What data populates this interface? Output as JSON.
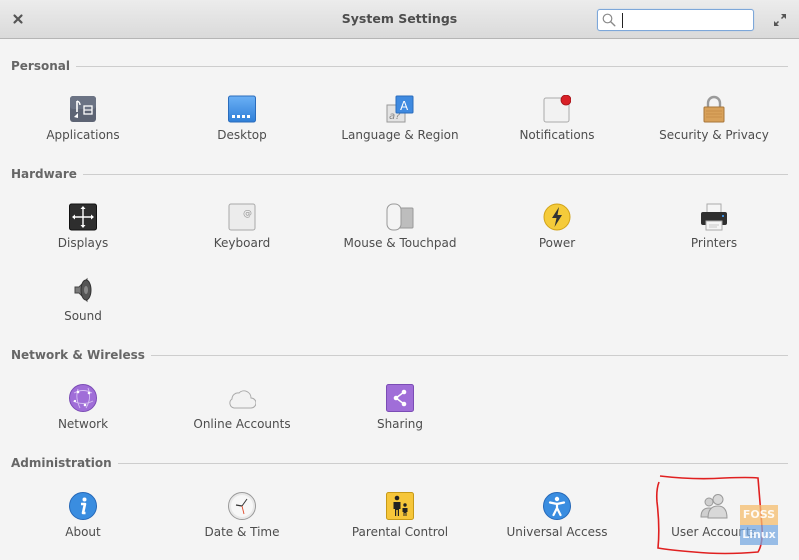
{
  "window": {
    "title": "System Settings",
    "search": {
      "value": "",
      "placeholder": ""
    },
    "close_icon": "close-icon",
    "maximize_icon": "maximize-icon"
  },
  "sections": [
    {
      "title": "Personal",
      "items": [
        {
          "label": "Applications",
          "icon": "applications-icon"
        },
        {
          "label": "Desktop",
          "icon": "desktop-icon"
        },
        {
          "label": "Language & Region",
          "icon": "language-icon"
        },
        {
          "label": "Notifications",
          "icon": "notifications-icon"
        },
        {
          "label": "Security & Privacy",
          "icon": "lock-icon"
        }
      ]
    },
    {
      "title": "Hardware",
      "items": [
        {
          "label": "Displays",
          "icon": "displays-icon"
        },
        {
          "label": "Keyboard",
          "icon": "keyboard-icon"
        },
        {
          "label": "Mouse & Touchpad",
          "icon": "mouse-icon"
        },
        {
          "label": "Power",
          "icon": "power-icon"
        },
        {
          "label": "Printers",
          "icon": "printer-icon"
        },
        {
          "label": "Sound",
          "icon": "speaker-icon"
        }
      ]
    },
    {
      "title": "Network & Wireless",
      "items": [
        {
          "label": "Network",
          "icon": "network-icon"
        },
        {
          "label": "Online Accounts",
          "icon": "cloud-icon"
        },
        {
          "label": "Sharing",
          "icon": "share-icon"
        }
      ]
    },
    {
      "title": "Administration",
      "items": [
        {
          "label": "About",
          "icon": "info-icon"
        },
        {
          "label": "Date & Time",
          "icon": "clock-icon"
        },
        {
          "label": "Parental Control",
          "icon": "parental-control-icon"
        },
        {
          "label": "Universal Access",
          "icon": "accessibility-icon"
        },
        {
          "label": "User Accounts",
          "icon": "users-icon"
        }
      ]
    }
  ],
  "overlay": {
    "annotation": "red-hand-drawn-highlight",
    "watermark_top": "FOSS",
    "watermark_bottom": "Linux"
  }
}
